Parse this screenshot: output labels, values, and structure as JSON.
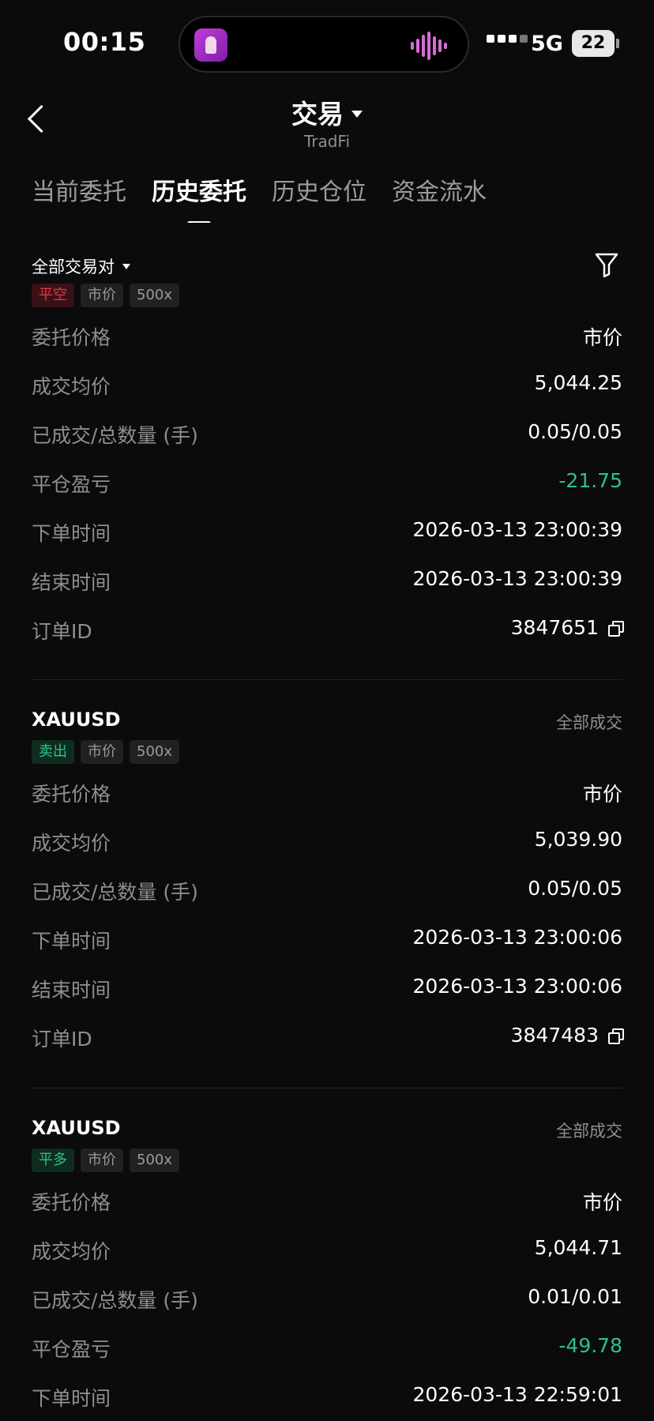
{
  "status_bar": {
    "time": "00:15",
    "network": "5G",
    "battery": "22"
  },
  "header": {
    "title": "交易",
    "subtitle": "TradFi"
  },
  "tabs": [
    {
      "label": "当前委托",
      "active": false
    },
    {
      "label": "历史委托",
      "active": true
    },
    {
      "label": "历史仓位",
      "active": false
    },
    {
      "label": "资金流水",
      "active": false
    }
  ],
  "filter": {
    "label": "全部交易对"
  },
  "orders": [
    {
      "symbol": "",
      "status": "",
      "tags": [
        {
          "text": "平空",
          "tone": "red"
        },
        {
          "text": "市价",
          "tone": "gray"
        },
        {
          "text": "500x",
          "tone": "gray"
        }
      ],
      "rows": [
        {
          "label": "委托价格",
          "value": "市价"
        },
        {
          "label": "成交均价",
          "value": "5,044.25"
        },
        {
          "label": "已成交/总数量 (手)",
          "value": "0.05/0.05"
        },
        {
          "label": "平仓盈亏",
          "value": "-21.75"
        },
        {
          "label": "下单时间",
          "value": "2026-03-13 23:00:39"
        },
        {
          "label": "结束时间",
          "value": "2026-03-13 23:00:39"
        },
        {
          "label": "订单ID",
          "value": "3847651"
        }
      ]
    },
    {
      "symbol": "XAUUSD",
      "status": "全部成交",
      "tags": [
        {
          "text": "卖出",
          "tone": "green"
        },
        {
          "text": "市价",
          "tone": "gray"
        },
        {
          "text": "500x",
          "tone": "gray"
        }
      ],
      "rows": [
        {
          "label": "委托价格",
          "value": "市价"
        },
        {
          "label": "成交均价",
          "value": "5,039.90"
        },
        {
          "label": "已成交/总数量 (手)",
          "value": "0.05/0.05"
        },
        {
          "label": "下单时间",
          "value": "2026-03-13 23:00:06"
        },
        {
          "label": "结束时间",
          "value": "2026-03-13 23:00:06"
        },
        {
          "label": "订单ID",
          "value": "3847483"
        }
      ]
    },
    {
      "symbol": "XAUUSD",
      "status": "全部成交",
      "tags": [
        {
          "text": "平多",
          "tone": "green"
        },
        {
          "text": "市价",
          "tone": "gray"
        },
        {
          "text": "500x",
          "tone": "gray"
        }
      ],
      "rows": [
        {
          "label": "委托价格",
          "value": "市价"
        },
        {
          "label": "成交均价",
          "value": "5,044.71"
        },
        {
          "label": "已成交/总数量 (手)",
          "value": "0.01/0.01"
        },
        {
          "label": "平仓盈亏",
          "value": "-49.78"
        },
        {
          "label": "下单时间",
          "value": "2026-03-13 22:59:01"
        }
      ]
    }
  ]
}
